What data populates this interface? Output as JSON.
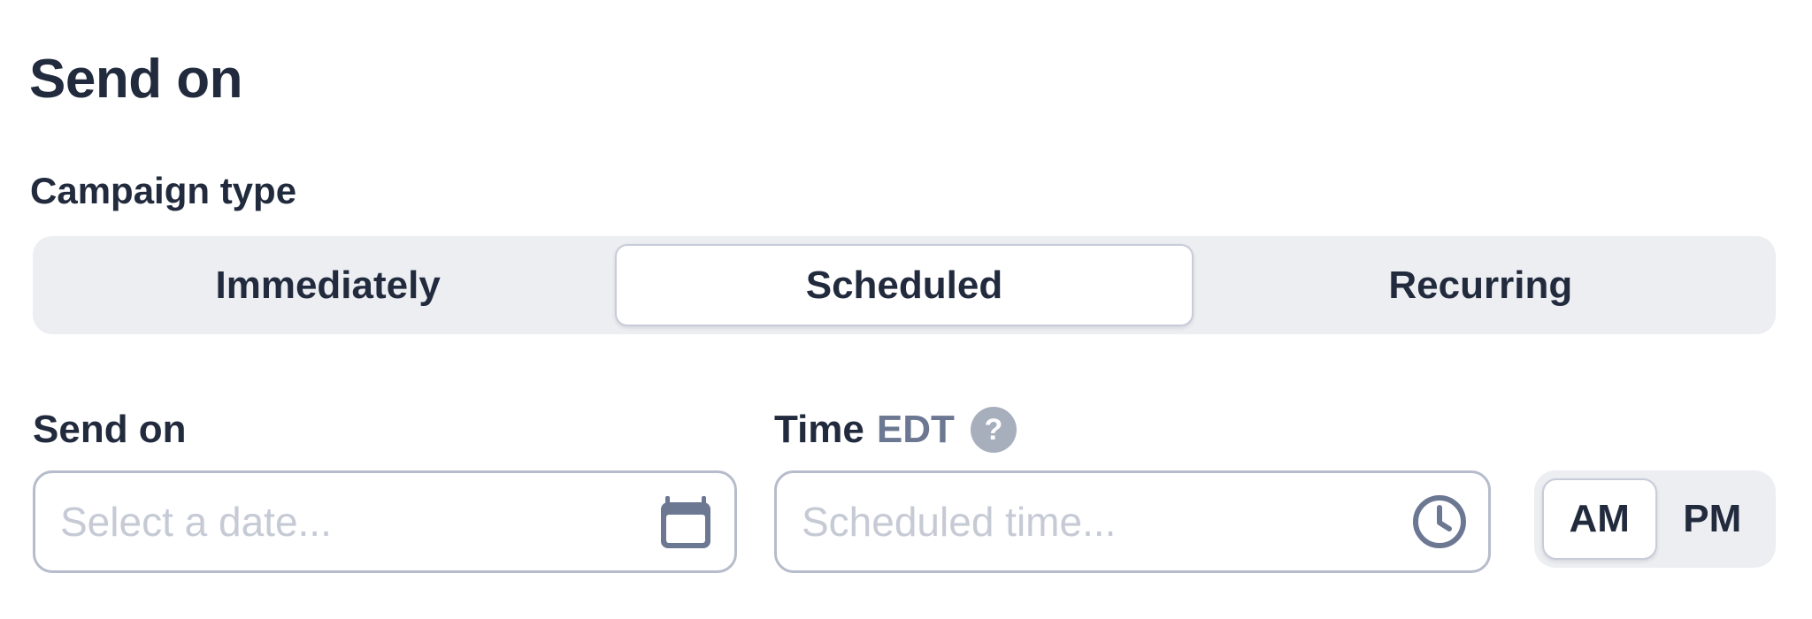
{
  "page": {
    "title": "Send on"
  },
  "campaign_type": {
    "label": "Campaign type",
    "options": [
      {
        "label": "Immediately",
        "selected": false
      },
      {
        "label": "Scheduled",
        "selected": true
      },
      {
        "label": "Recurring",
        "selected": false
      }
    ]
  },
  "send_on_field": {
    "label": "Send on",
    "value": "",
    "placeholder": "Select a date...",
    "icon": "calendar-icon"
  },
  "time_field": {
    "label": "Time",
    "timezone": "EDT",
    "help_icon": "help-icon",
    "help_glyph": "?",
    "value": "",
    "placeholder": "Scheduled time...",
    "icon": "clock-icon"
  },
  "meridiem": {
    "options": [
      {
        "label": "AM",
        "selected": true
      },
      {
        "label": "PM",
        "selected": false
      }
    ]
  },
  "colors": {
    "text": "#222b3d",
    "muted_text": "#6c7792",
    "placeholder": "#c5cad5",
    "segment_bg": "#eceef2",
    "border": "#b6bccb",
    "icon": "#6c7792",
    "help_bg": "#a7aebc"
  }
}
